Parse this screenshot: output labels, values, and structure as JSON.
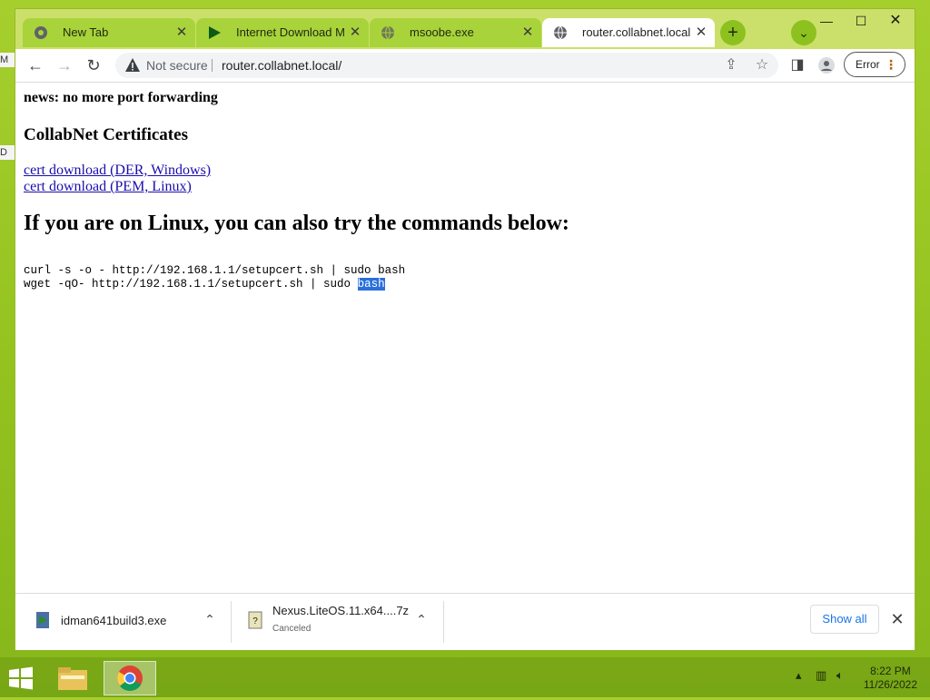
{
  "desktop": {
    "edge_labels": [
      "M",
      "D"
    ]
  },
  "tabs": [
    {
      "label": "New Tab",
      "icon": "chrome-icon",
      "active": false
    },
    {
      "label": "Internet Download Mar",
      "icon": "idm-play-icon",
      "active": false
    },
    {
      "label": "msoobe.exe",
      "icon": "globe-icon",
      "active": false
    },
    {
      "label": "router.collabnet.local",
      "icon": "globe-icon",
      "active": true
    }
  ],
  "toolbar": {
    "security_label": "Not secure",
    "url": "router.collabnet.local/",
    "error_label": "Error"
  },
  "page": {
    "news": "news: no more port forwarding",
    "heading": "CollabNet Certificates",
    "links": [
      "cert download (DER, Windows)",
      "cert download (PEM, Linux)"
    ],
    "linux_heading": "If you are on Linux, you can also try the commands below:",
    "command1": "curl -s -o - http://192.168.1.1/setupcert.sh | sudo bash",
    "command2_prefix": "wget -qO- http://192.168.1.1/setupcert.sh | sudo ",
    "command2_selected": "bash"
  },
  "downloads": {
    "items": [
      {
        "name": "idman641build3.exe",
        "status": ""
      },
      {
        "name": "Nexus.LiteOS.11.x64....7z",
        "status": "Canceled"
      }
    ],
    "show_all": "Show all"
  },
  "taskbar": {
    "time": "8:22 PM",
    "date": "11/26/2022"
  },
  "colors": {
    "desktop": "#93c21f",
    "tab_inactive": "#a9d33a",
    "link": "#1a0dab",
    "selection": "#2a6fdb",
    "accent_blue": "#1a73e8"
  }
}
